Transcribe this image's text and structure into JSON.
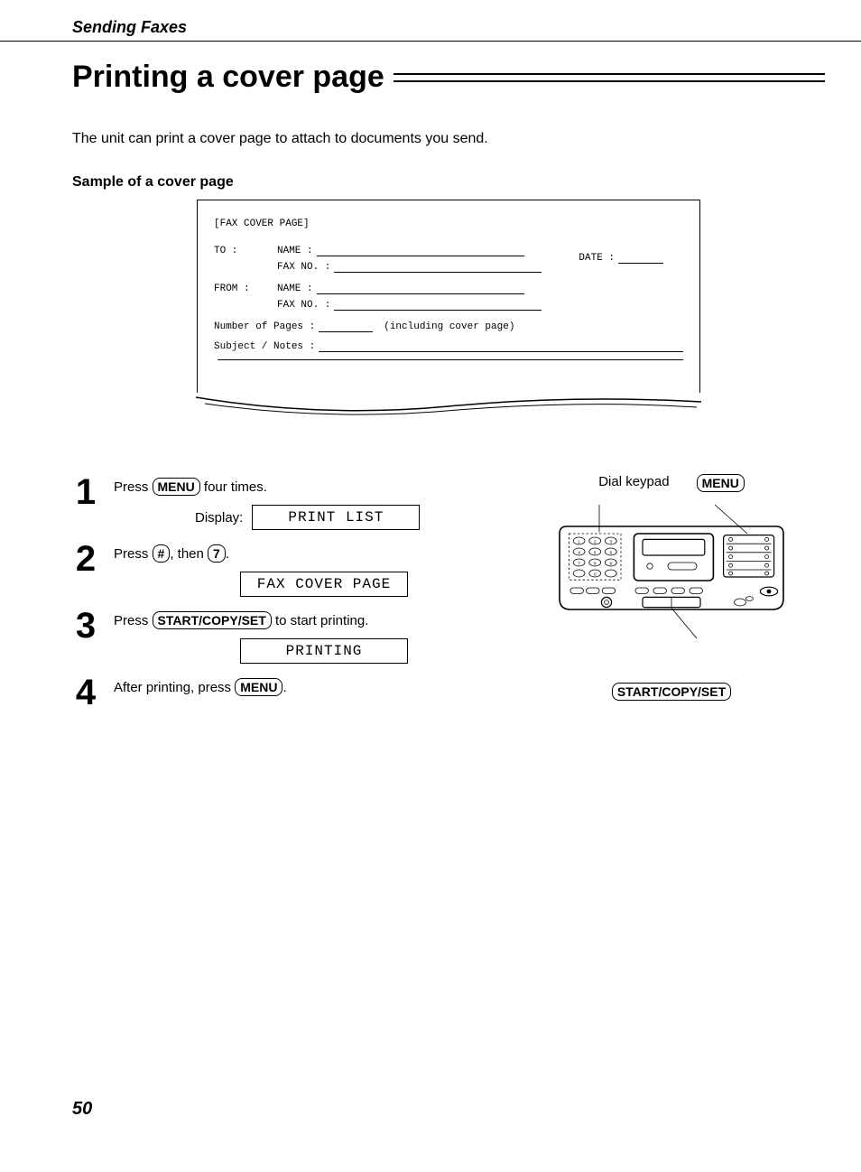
{
  "header": {
    "section": "Sending Faxes"
  },
  "title": "Printing a cover page",
  "intro": "The unit can print a cover page to attach to documents you send.",
  "sample_heading": "Sample of a cover page",
  "cover": {
    "title": "[FAX COVER PAGE]",
    "to": "TO :",
    "from": "FROM :",
    "name": "NAME :",
    "faxno": "FAX NO. :",
    "date": "DATE :",
    "numpages": "Number of Pages :",
    "incl": "(including cover page)",
    "subject": "Subject / Notes :"
  },
  "steps": {
    "s1": {
      "num": "1",
      "pre": "Press ",
      "key": "MENU",
      "post": " four times.",
      "disp_label": "Display:",
      "disp_val": "PRINT LIST"
    },
    "s2": {
      "num": "2",
      "pre": "Press ",
      "key1": "#",
      "mid": ", then ",
      "key2": "7",
      "post": ".",
      "disp_val": "FAX COVER PAGE"
    },
    "s3": {
      "num": "3",
      "pre": "Press ",
      "key": "START/COPY/SET",
      "post": " to start printing.",
      "disp_val": "PRINTING"
    },
    "s4": {
      "num": "4",
      "pre": "After printing, press ",
      "key": "MENU",
      "post": "."
    }
  },
  "panel": {
    "dial": "Dial keypad",
    "menu": "MENU",
    "scs": "START/COPY/SET"
  },
  "page_number": "50"
}
